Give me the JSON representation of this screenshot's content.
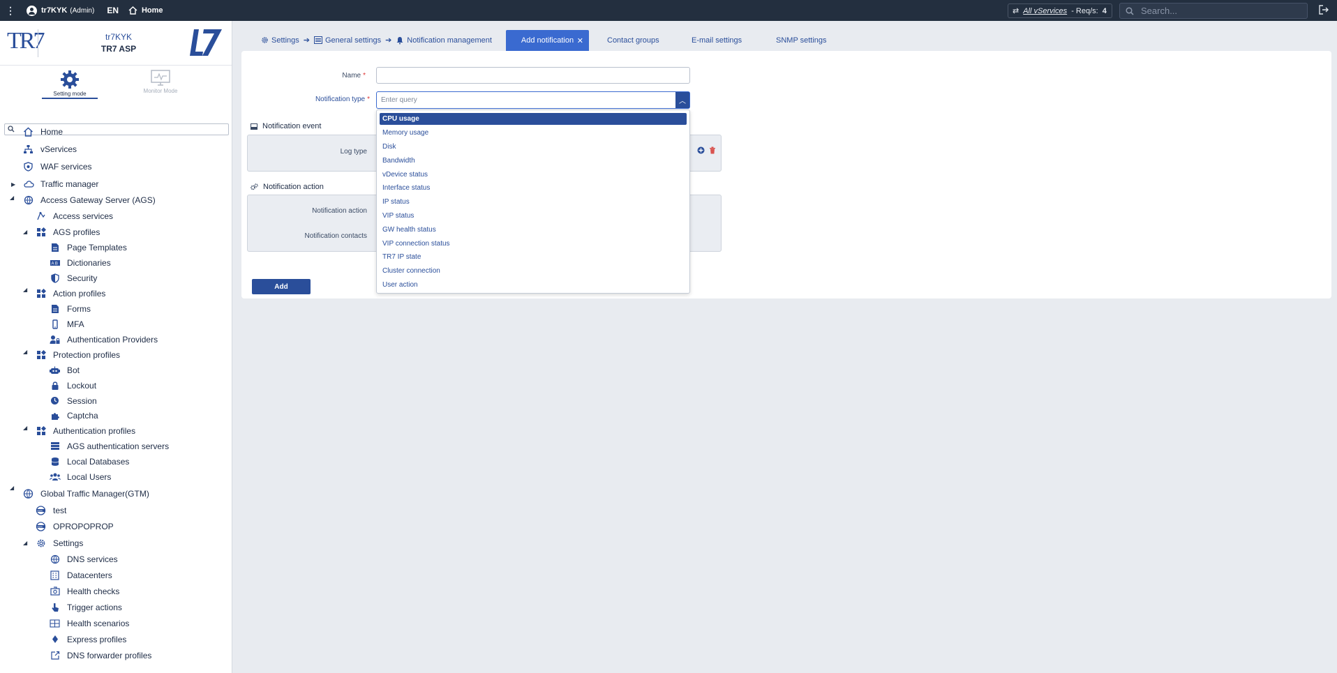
{
  "topbar": {
    "username": "tr7KYK",
    "role": "(Admin)",
    "language": "EN",
    "home_label": "Home",
    "vservices_link": "All vServices",
    "reqs_label": "- Req/s:",
    "reqs_count": "4",
    "search_placeholder": "Search..."
  },
  "brand": {
    "logo_text": "TR7",
    "tenant": "tr7KYK",
    "product": "TR7 ASP"
  },
  "modes": {
    "setting": "Setting mode",
    "monitor": "Monitor Mode"
  },
  "sidebar": {
    "items": [
      {
        "label": "Home",
        "icon": "home-icon"
      },
      {
        "label": "vServices",
        "icon": "network-icon"
      },
      {
        "label": "WAF services",
        "icon": "shield-icon"
      },
      {
        "label": "Traffic manager",
        "icon": "cloud-icon"
      },
      {
        "label": "Access Gateway Server (AGS)",
        "icon": "globe-icon"
      },
      {
        "label": "Access services",
        "icon": "access-icon"
      },
      {
        "label": "AGS profiles",
        "icon": "profiles-icon"
      },
      {
        "label": "Page Templates",
        "icon": "page-icon"
      },
      {
        "label": "Dictionaries",
        "icon": "dictionary-icon"
      },
      {
        "label": "Security",
        "icon": "shield-half-icon"
      },
      {
        "label": "Action profiles",
        "icon": "profiles-icon"
      },
      {
        "label": "Forms",
        "icon": "form-icon"
      },
      {
        "label": "MFA",
        "icon": "mobile-icon"
      },
      {
        "label": "Authentication Providers",
        "icon": "user-lock-icon"
      },
      {
        "label": "Protection profiles",
        "icon": "profiles-icon"
      },
      {
        "label": "Bot",
        "icon": "robot-icon"
      },
      {
        "label": "Lockout",
        "icon": "lock-icon"
      },
      {
        "label": "Session",
        "icon": "clock-icon"
      },
      {
        "label": "Captcha",
        "icon": "puzzle-icon"
      },
      {
        "label": "Authentication profiles",
        "icon": "profiles-icon"
      },
      {
        "label": "AGS authentication servers",
        "icon": "server-icon"
      },
      {
        "label": "Local Databases",
        "icon": "database-icon"
      },
      {
        "label": "Local Users",
        "icon": "users-icon"
      },
      {
        "label": "Global Traffic Manager(GTM)",
        "icon": "globe-net-icon"
      },
      {
        "label": "test",
        "icon": "www-icon"
      },
      {
        "label": "OPROPOPROP",
        "icon": "www-icon"
      },
      {
        "label": "Settings",
        "icon": "gear-icon"
      },
      {
        "label": "DNS services",
        "icon": "globe-icon"
      },
      {
        "label": "Datacenters",
        "icon": "building-icon"
      },
      {
        "label": "Health checks",
        "icon": "health-icon"
      },
      {
        "label": "Trigger actions",
        "icon": "pointer-icon"
      },
      {
        "label": "Health scenarios",
        "icon": "scenario-icon"
      },
      {
        "label": "Express profiles",
        "icon": "diamond-icon"
      },
      {
        "label": "DNS forwarder profiles",
        "icon": "forward-icon"
      }
    ]
  },
  "tabs": {
    "crumb_settings": "Settings",
    "crumb_general": "General settings",
    "crumb_notification": "Notification management",
    "active": "Add notification",
    "contact_groups": "Contact groups",
    "email_settings": "E-mail settings",
    "snmp_settings": "SNMP settings"
  },
  "form": {
    "name_label": "Name",
    "notification_type_label": "Notification type",
    "notification_type_placeholder": "Enter query",
    "notification_event_title": "Notification event",
    "log_type_label": "Log type",
    "notification_action_title": "Notification action",
    "notification_action_label": "Notification action",
    "notification_contacts_label": "Notification contacts",
    "add_button": "Add"
  },
  "dropdown": {
    "selected": "CPU usage",
    "options": [
      "CPU usage",
      "Memory usage",
      "Disk",
      "Bandwidth",
      "vDevice status",
      "Interface status",
      "IP status",
      "VIP status",
      "GW health status",
      "VIP connection status",
      "TR7 IP state",
      "Cluster connection",
      "User action"
    ]
  },
  "colors": {
    "accent": "#2a4e9a",
    "active_tab": "#3a6ad0",
    "topbar": "#232f3f"
  }
}
